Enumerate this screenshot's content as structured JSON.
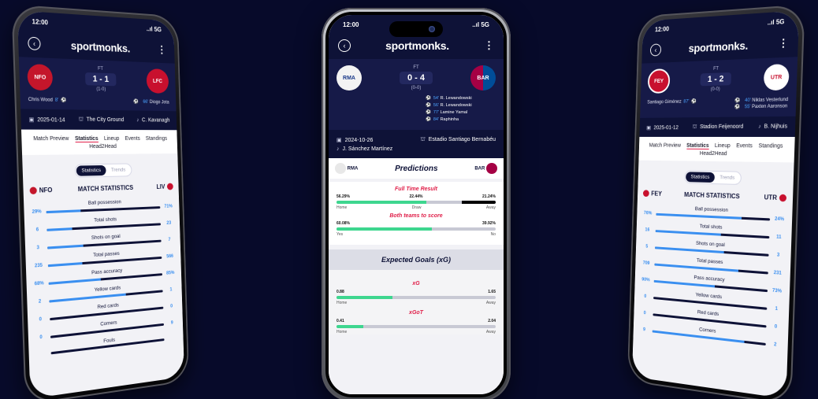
{
  "app": {
    "logo": "sportmonks.",
    "time": "12:00",
    "signal": "..ıl 5G"
  },
  "left": {
    "score": "1 - 1",
    "ft": "FT",
    "ht": "(1-0)",
    "home_crest": "NFO",
    "away_crest": "LFC",
    "home_scorer": "Chris Wood",
    "home_min": "8'",
    "away_scorer": "Diogo Jota",
    "away_min": "66'",
    "date": "2025-01-14",
    "venue": "The City Ground",
    "referee": "C. Kavanagh",
    "tabs": [
      "Match Preview",
      "Statistics",
      "Lineup",
      "Events",
      "Standings",
      "Head2Head"
    ],
    "toggle": [
      "Statistics",
      "Trends"
    ],
    "ms_title": "MATCH STATISTICS",
    "home_abbr": "NFO",
    "away_abbr": "LIV",
    "stats": [
      {
        "label": "Ball possession",
        "home": "29%",
        "away": "71%",
        "frac": 0.29
      },
      {
        "label": "Total shots",
        "home": "6",
        "away": "23",
        "frac": 0.21
      },
      {
        "label": "Shots on goal",
        "home": "3",
        "away": "7",
        "frac": 0.3
      },
      {
        "label": "Total passes",
        "home": "235",
        "away": "566",
        "frac": 0.29
      },
      {
        "label": "Pass accuracy",
        "home": "68%",
        "away": "85%",
        "frac": 0.44
      },
      {
        "label": "Yellow cards",
        "home": "2",
        "away": "1",
        "frac": 0.66
      },
      {
        "label": "Red cards",
        "home": "0",
        "away": "0",
        "frac": 0.0
      },
      {
        "label": "Corners",
        "home": "0",
        "away": "9",
        "frac": 0.0
      },
      {
        "label": "Fouls",
        "home": "",
        "away": "",
        "frac": 0.0
      }
    ]
  },
  "center": {
    "score": "0 - 4",
    "ft": "FT",
    "ht": "(0-0)",
    "home_crest": "RMA",
    "away_crest": "BAR",
    "scorers": [
      {
        "min": "54'",
        "name": "R. Lewandowski"
      },
      {
        "min": "56'",
        "name": "R. Lewandowski"
      },
      {
        "min": "77'",
        "name": "Lamine Yamal"
      },
      {
        "min": "84'",
        "name": "Raphinha"
      }
    ],
    "date": "2024-10-26",
    "venue": "Estadio Santiago Bernabéu",
    "referee": "J. Sánchez Martínez",
    "pred_title": "Predictions",
    "home_abbr": "RMA",
    "away_abbr": "BAR",
    "ftr_title": "Full Time Result",
    "ftr": {
      "home": "56.29%",
      "draw": "22.44%",
      "away": "21.24%",
      "home_v": 56.29,
      "draw_v": 22.44,
      "away_v": 21.24
    },
    "ftr_labels": [
      "Home",
      "Draw",
      "Away"
    ],
    "btts_title": "Both teams to score",
    "btts": {
      "yes": "60.08%",
      "no": "39.92%",
      "yes_v": 60.08
    },
    "btts_labels": [
      "Yes",
      "No"
    ],
    "xg_title": "Expected Goals (xG)",
    "xg_sub": "xG",
    "xg": {
      "home": "0.88",
      "away": "1.65",
      "home_frac": 0.35
    },
    "xgot_sub": "xGoT",
    "xgot": {
      "home": "0.41",
      "away": "2.04",
      "home_frac": 0.17
    },
    "ha_labels": [
      "Home",
      "Away"
    ]
  },
  "right": {
    "score": "1 - 2",
    "ft": "FT",
    "ht": "(0-0)",
    "home_crest": "FEY",
    "away_crest": "UTR",
    "home_scorer": "Santiago Giménez",
    "home_min": "87'",
    "away_scorers": [
      {
        "min": "40'",
        "name": "Niklas Vesterlund"
      },
      {
        "min": "55'",
        "name": "Paxten Aaronson"
      }
    ],
    "date": "2025-01-12",
    "venue": "Stadion Feijenoord",
    "referee": "B. Nijhuis",
    "tabs": [
      "Match Preview",
      "Statistics",
      "Lineup",
      "Events",
      "Standings",
      "Head2Head"
    ],
    "toggle": [
      "Statistics",
      "Trends"
    ],
    "ms_title": "MATCH STATISTICS",
    "home_abbr": "FEY",
    "away_abbr": "UTR",
    "stats": [
      {
        "label": "Ball possession",
        "home": "76%",
        "away": "24%",
        "frac": 0.76
      },
      {
        "label": "Total shots",
        "home": "16",
        "away": "11",
        "frac": 0.59
      },
      {
        "label": "Shots on goal",
        "home": "5",
        "away": "3",
        "frac": 0.62
      },
      {
        "label": "Total passes",
        "home": "709",
        "away": "231",
        "frac": 0.75
      },
      {
        "label": "Pass accuracy",
        "home": "90%",
        "away": "73%",
        "frac": 0.55
      },
      {
        "label": "Yellow cards",
        "home": "0",
        "away": "1",
        "frac": 0.0
      },
      {
        "label": "Red cards",
        "home": "0",
        "away": "0",
        "frac": 0.0
      },
      {
        "label": "Corners",
        "home": "9",
        "away": "2",
        "frac": 0.82
      }
    ]
  }
}
